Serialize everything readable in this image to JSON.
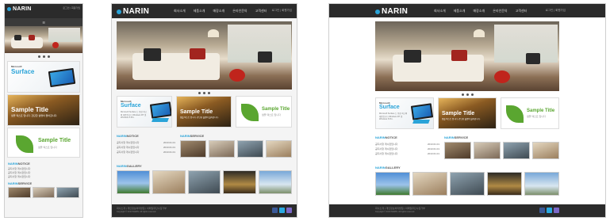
{
  "brand": {
    "logo_text": "NARIN",
    "accent": "#29a3d8",
    "header_bg": "#2b2b2b"
  },
  "header": {
    "top_links": "로그인 | 회원가입",
    "nav": [
      "회사소개",
      "제품소개",
      "매장소개",
      "온라인문의",
      "고객센터"
    ]
  },
  "promo": {
    "surface": {
      "brand": "Microsoft",
      "title": "Surface",
      "desc": "Microsoft Surface 는 위한 최고의 제품입니다 Windows RT 및 Windows 8 Pro."
    },
    "sample_dark": {
      "title": "Sample Title",
      "desc": "샘플 텍스트 입니다. 간단한 설명이 들어갑니다."
    },
    "sample_leaf": {
      "title": "Sample Title",
      "desc": "샘플 텍스트 입니다"
    }
  },
  "sections": {
    "notice": {
      "prefix": "NARIN",
      "label": "NOTICE",
      "rows": [
        {
          "text": "공지사항 게시판입니다",
          "date": "2013.01.01"
        },
        {
          "text": "공지사항 게시판입니다",
          "date": "2013.01.01"
        },
        {
          "text": "공지사항 게시판입니다",
          "date": "2013.01.01"
        }
      ]
    },
    "service": {
      "prefix": "NARIN",
      "label": "SERVICE"
    },
    "gallery": {
      "prefix": "NARIN",
      "label": "GALLERY"
    }
  },
  "footer": {
    "text": "회사소개 | 개인정보처리방침 | 이메일무단수집거부",
    "copyright": "Copyright © 2013 NARIN. All rights reserved."
  },
  "icons": [
    "facebook-icon",
    "twitter-icon",
    "google-plus-icon",
    "menu-icon"
  ]
}
